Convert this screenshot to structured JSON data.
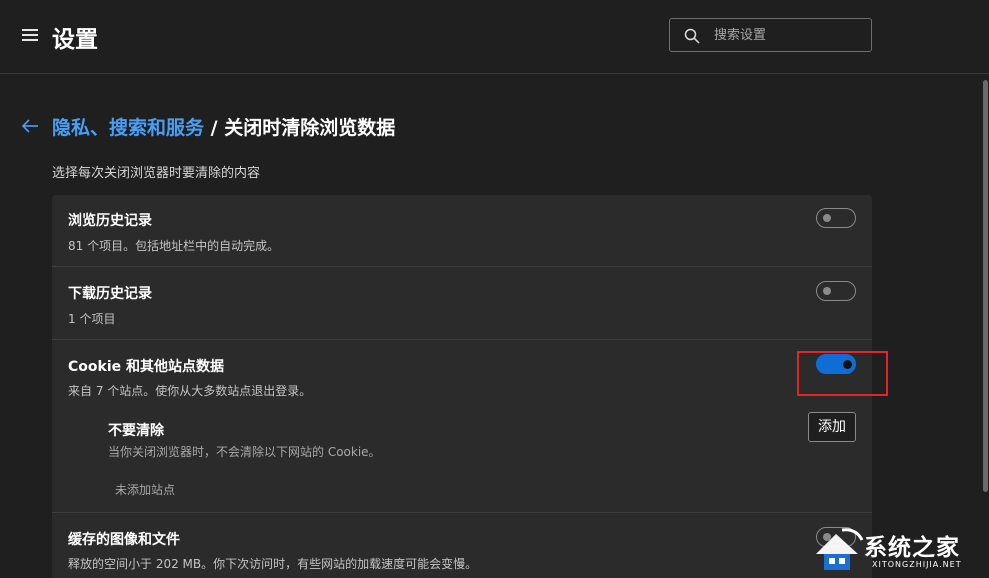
{
  "header": {
    "title": "设置",
    "search_placeholder": "搜索设置"
  },
  "breadcrumb": {
    "parent": "隐私、搜索和服务",
    "separator": " / ",
    "current": "关闭时清除浏览数据"
  },
  "subtitle": "选择每次关闭浏览器时要清除的内容",
  "items": [
    {
      "title": "浏览历史记录",
      "desc": "81 个项目。包括地址栏中的自动完成。",
      "enabled": false
    },
    {
      "title": "下载历史记录",
      "desc": "1 个项目",
      "enabled": false
    },
    {
      "title": "Cookie 和其他站点数据",
      "desc": "来自 7 个站点。使你从大多数站点退出登录。",
      "enabled": true,
      "exceptions": {
        "title": "不要清除",
        "desc": "当你关闭浏览器时，不会清除以下网站的 Cookie。",
        "add_label": "添加",
        "empty_text": "未添加站点"
      }
    },
    {
      "title": "缓存的图像和文件",
      "desc": "释放的空间小于 202 MB。你下次访问时，有些网站的加载速度可能会变慢。",
      "enabled": false
    }
  ],
  "watermark": {
    "name": "系统之家",
    "url_text": "XITONGZHIJIA.NET"
  },
  "colors": {
    "background": "#1f1f1f",
    "card": "#2b2b2b",
    "accent": "#0f6ed6",
    "link": "#4a9ff5",
    "highlight": "#e3242b"
  }
}
